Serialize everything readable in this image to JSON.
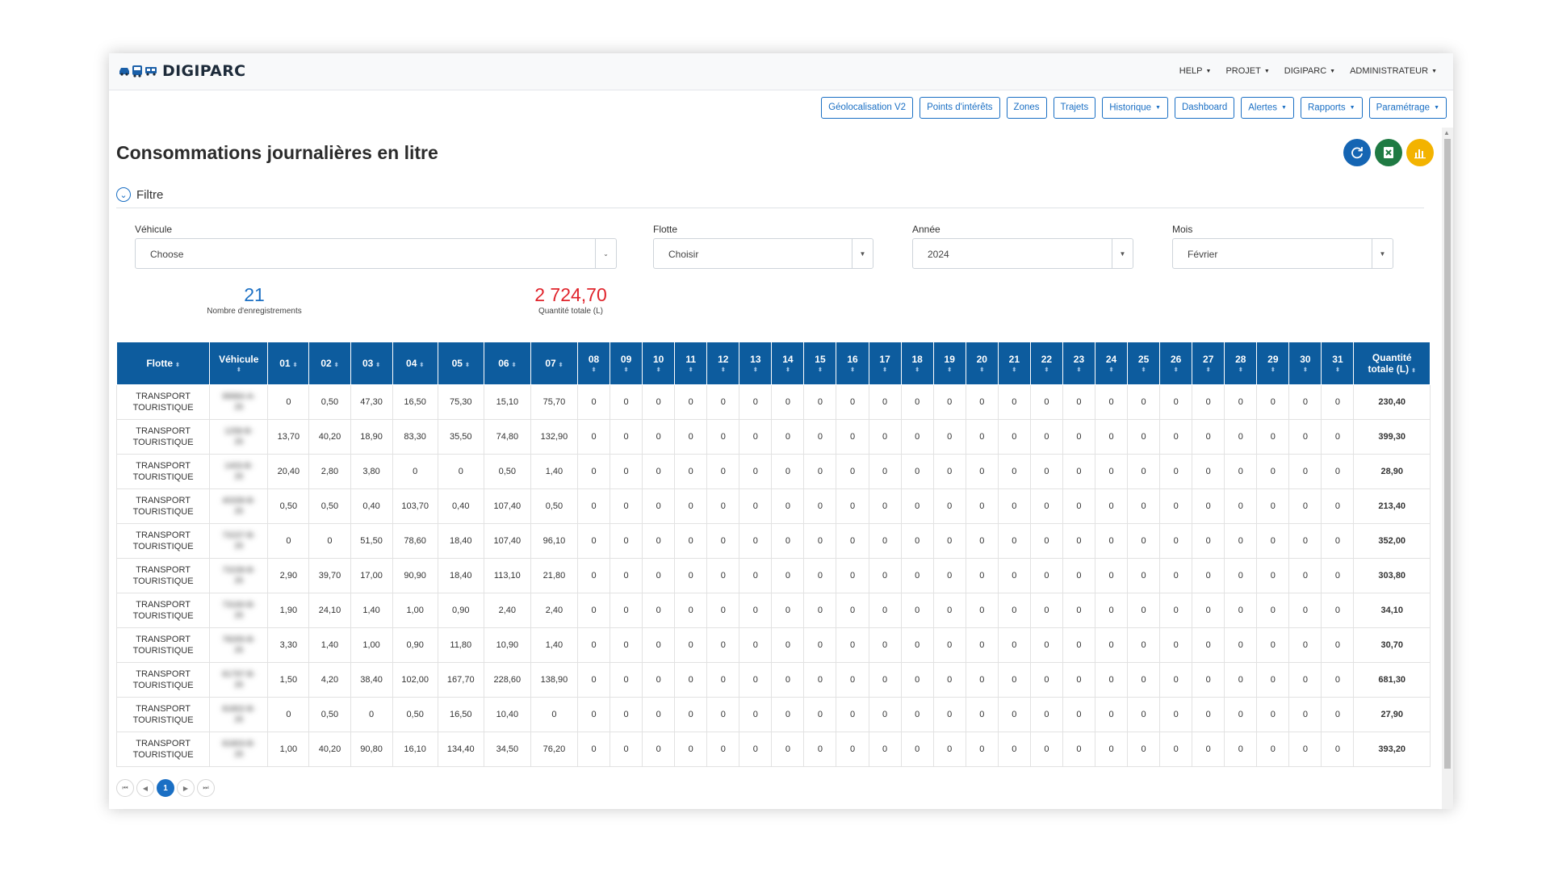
{
  "app": {
    "name": "DIGIPARC"
  },
  "top_menu": [
    "HELP",
    "PROJET",
    "DIGIPARC",
    "ADMINISTRATEUR"
  ],
  "nav_buttons": [
    {
      "label": "Géolocalisation V2",
      "dropdown": false
    },
    {
      "label": "Points d'intérêts",
      "dropdown": false
    },
    {
      "label": "Zones",
      "dropdown": false
    },
    {
      "label": "Trajets",
      "dropdown": false
    },
    {
      "label": "Historique",
      "dropdown": true
    },
    {
      "label": "Dashboard",
      "dropdown": false
    },
    {
      "label": "Alertes",
      "dropdown": true
    },
    {
      "label": "Rapports",
      "dropdown": true
    },
    {
      "label": "Paramétrage",
      "dropdown": true
    }
  ],
  "page_title": "Consommations journalières en litre",
  "filter": {
    "toggle_label": "Filtre",
    "vehicule": {
      "label": "Véhicule",
      "value": "Choose"
    },
    "flotte": {
      "label": "Flotte",
      "value": "Choisir"
    },
    "annee": {
      "label": "Année",
      "value": "2024"
    },
    "mois": {
      "label": "Mois",
      "value": "Février"
    }
  },
  "stats": {
    "records": {
      "value": "21",
      "label": "Nombre d'enregistrements"
    },
    "total": {
      "value": "2 724,70",
      "label": "Quantité totale (L)"
    }
  },
  "colors": {
    "header": "#0d5c9e",
    "accent": "#1a6fc4",
    "total_red": "#e0232b",
    "excel_green": "#1f7a43",
    "chart_yellow": "#f3b300"
  },
  "table": {
    "headers": {
      "flotte": "Flotte",
      "vehicule": "Véhicule",
      "days": [
        "01",
        "02",
        "03",
        "04",
        "05",
        "06",
        "07",
        "08",
        "09",
        "10",
        "11",
        "12",
        "13",
        "14",
        "15",
        "16",
        "17",
        "18",
        "19",
        "20",
        "21",
        "22",
        "23",
        "24",
        "25",
        "26",
        "27",
        "28",
        "29",
        "30",
        "31"
      ],
      "total_line1": "Quantité",
      "total_line2": "totale (L)"
    },
    "rows": [
      {
        "flotte": [
          "TRANSPORT",
          "TOURISTIQUE"
        ],
        "vehicule": [
          "99984-A-",
          "26"
        ],
        "days": [
          "0",
          "0,50",
          "47,30",
          "16,50",
          "75,30",
          "15,10",
          "75,70"
        ],
        "total": "230,40"
      },
      {
        "flotte": [
          "TRANSPORT",
          "TOURISTIQUE"
        ],
        "vehicule": [
          "1258-B-",
          "26"
        ],
        "days": [
          "13,70",
          "40,20",
          "18,90",
          "83,30",
          "35,50",
          "74,80",
          "132,90"
        ],
        "total": "399,30"
      },
      {
        "flotte": [
          "TRANSPORT",
          "TOURISTIQUE"
        ],
        "vehicule": [
          "1403-B-",
          "26"
        ],
        "days": [
          "20,40",
          "2,80",
          "3,80",
          "0",
          "0",
          "0,50",
          "1,40"
        ],
        "total": "28,90"
      },
      {
        "flotte": [
          "TRANSPORT",
          "TOURISTIQUE"
        ],
        "vehicule": [
          "40339-B-",
          "26"
        ],
        "days": [
          "0,50",
          "0,50",
          "0,40",
          "103,70",
          "0,40",
          "107,40",
          "0,50"
        ],
        "total": "213,40"
      },
      {
        "flotte": [
          "TRANSPORT",
          "TOURISTIQUE"
        ],
        "vehicule": [
          "73157-B-",
          "26"
        ],
        "days": [
          "0",
          "0",
          "51,50",
          "78,60",
          "18,40",
          "107,40",
          "96,10"
        ],
        "total": "352,00"
      },
      {
        "flotte": [
          "TRANSPORT",
          "TOURISTIQUE"
        ],
        "vehicule": [
          "73158-B-",
          "26"
        ],
        "days": [
          "2,90",
          "39,70",
          "17,00",
          "90,90",
          "18,40",
          "113,10",
          "21,80"
        ],
        "total": "303,80"
      },
      {
        "flotte": [
          "TRANSPORT",
          "TOURISTIQUE"
        ],
        "vehicule": [
          "73160-B-",
          "26"
        ],
        "days": [
          "1,90",
          "24,10",
          "1,40",
          "1,00",
          "0,90",
          "2,40",
          "2,40"
        ],
        "total": "34,10"
      },
      {
        "flotte": [
          "TRANSPORT",
          "TOURISTIQUE"
        ],
        "vehicule": [
          "78265-B-",
          "26"
        ],
        "days": [
          "3,30",
          "1,40",
          "1,00",
          "0,90",
          "11,80",
          "10,90",
          "1,40"
        ],
        "total": "30,70"
      },
      {
        "flotte": [
          "TRANSPORT",
          "TOURISTIQUE"
        ],
        "vehicule": [
          "81797-B-",
          "26"
        ],
        "days": [
          "1,50",
          "4,20",
          "38,40",
          "102,00",
          "167,70",
          "228,60",
          "138,90"
        ],
        "total": "681,30"
      },
      {
        "flotte": [
          "TRANSPORT",
          "TOURISTIQUE"
        ],
        "vehicule": [
          "81802-B-",
          "26"
        ],
        "days": [
          "0",
          "0,50",
          "0",
          "0,50",
          "16,50",
          "10,40",
          "0"
        ],
        "total": "27,90"
      },
      {
        "flotte": [
          "TRANSPORT",
          "TOURISTIQUE"
        ],
        "vehicule": [
          "81803-B-",
          "26"
        ],
        "days": [
          "1,00",
          "40,20",
          "90,80",
          "16,10",
          "134,40",
          "34,50",
          "76,20"
        ],
        "total": "393,20"
      }
    ],
    "zero": "0"
  },
  "pagination": {
    "first": "⏮",
    "prev": "◀",
    "current": "1",
    "next": "▶",
    "last": "⏭"
  }
}
